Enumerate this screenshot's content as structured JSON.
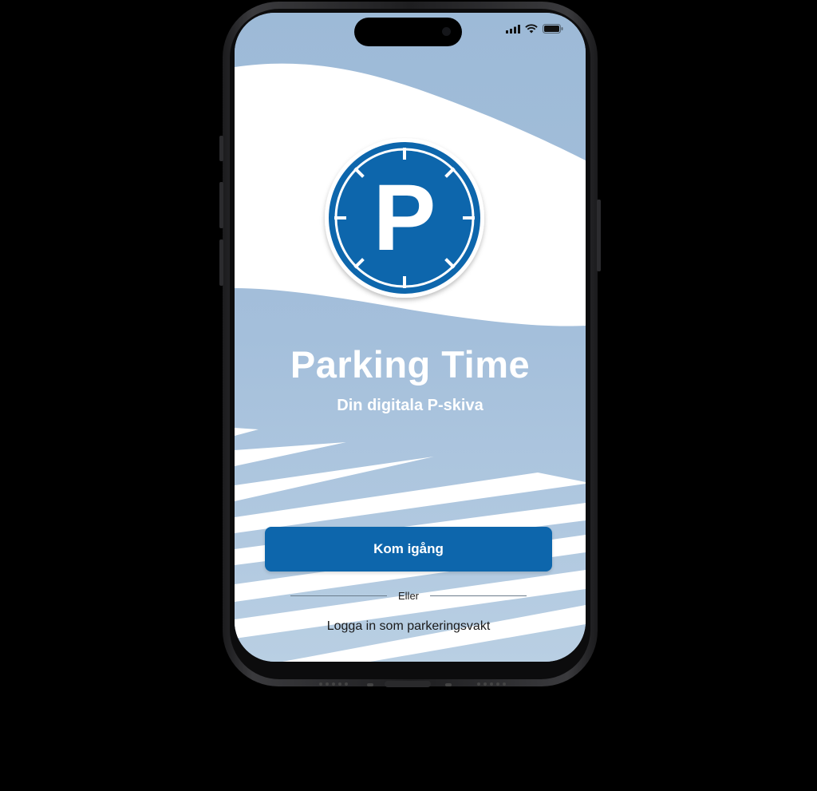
{
  "app": {
    "title": "Parking Time",
    "subtitle": "Din digitala P-skiva",
    "logo_letter": "P"
  },
  "actions": {
    "primary_label": "Kom igång",
    "divider_label": "Eller",
    "secondary_label": "Logga in som parkeringsvakt"
  },
  "status_bar": {
    "icons": [
      "signal-icon",
      "wifi-icon",
      "battery-icon"
    ]
  },
  "colors": {
    "brand_blue": "#0d66ac",
    "background_light_blue": "#a9c3dc",
    "wave_white": "#ffffff"
  }
}
